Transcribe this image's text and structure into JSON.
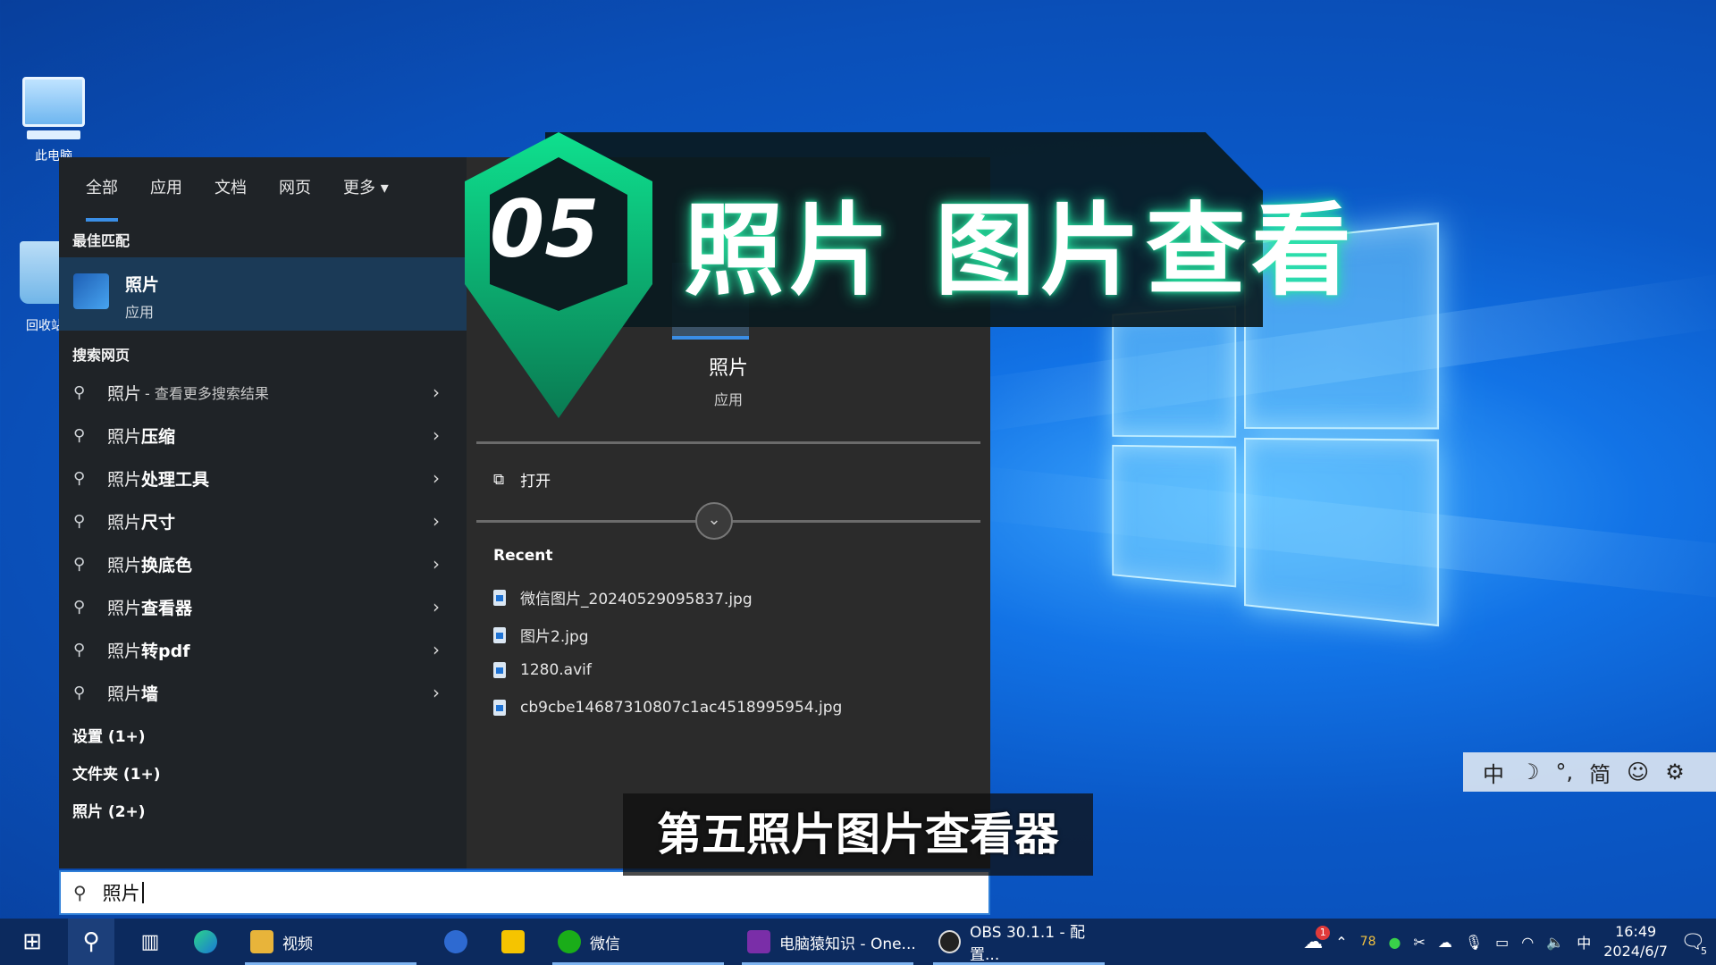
{
  "desktop": {
    "icons": [
      {
        "label": "此电脑"
      },
      {
        "label": "回收站"
      }
    ]
  },
  "search_panel": {
    "tabs": [
      "全部",
      "应用",
      "文档",
      "网页",
      "更多"
    ],
    "best_match_heading": "最佳匹配",
    "best_match": {
      "title": "照片",
      "subtitle": "应用"
    },
    "web_heading": "搜索网页",
    "web_results": [
      {
        "prefix": "照片",
        "rest": "",
        "hint": "- 查看更多搜索结果"
      },
      {
        "prefix": "照片",
        "rest": "压缩",
        "hint": ""
      },
      {
        "prefix": "照片",
        "rest": "处理工具",
        "hint": ""
      },
      {
        "prefix": "照片",
        "rest": "尺寸",
        "hint": ""
      },
      {
        "prefix": "照片",
        "rest": "换底色",
        "hint": ""
      },
      {
        "prefix": "照片",
        "rest": "查看器",
        "hint": ""
      },
      {
        "prefix": "照片",
        "rest": "转pdf",
        "hint": ""
      },
      {
        "prefix": "照片",
        "rest": "墙",
        "hint": ""
      }
    ],
    "groups": [
      "设置 (1+)",
      "文件夹 (1+)",
      "照片 (2+)"
    ],
    "detail": {
      "title": "照片",
      "subtitle": "应用",
      "open_label": "打开",
      "recent_heading": "Recent",
      "recent_files": [
        "微信图片_20240529095837.jpg",
        "图片2.jpg",
        "1280.avif",
        "cb9cbe14687310807c1ac4518995954.jpg"
      ]
    },
    "query": "照片"
  },
  "overlay": {
    "number": "05",
    "title": "照片 图片查看",
    "subtitle": "第五照片图片查看器"
  },
  "ime_bar": [
    "中",
    "☽",
    "°,",
    "简",
    "☺",
    "⚙"
  ],
  "taskbar": {
    "items": [
      {
        "label": "视频"
      },
      {
        "label": "微信"
      },
      {
        "label": "电脑猿知识 - One..."
      },
      {
        "label": "OBS 30.1.1 - 配置..."
      }
    ],
    "tray": {
      "weather_badge": "1",
      "temp": "78",
      "ime": "中",
      "time": "16:49",
      "date": "2024/6/7",
      "notifications": "5"
    }
  },
  "colors": {
    "accent": "#3a8ee6",
    "panel": "#1f2327",
    "glow": "#27e6a2"
  }
}
